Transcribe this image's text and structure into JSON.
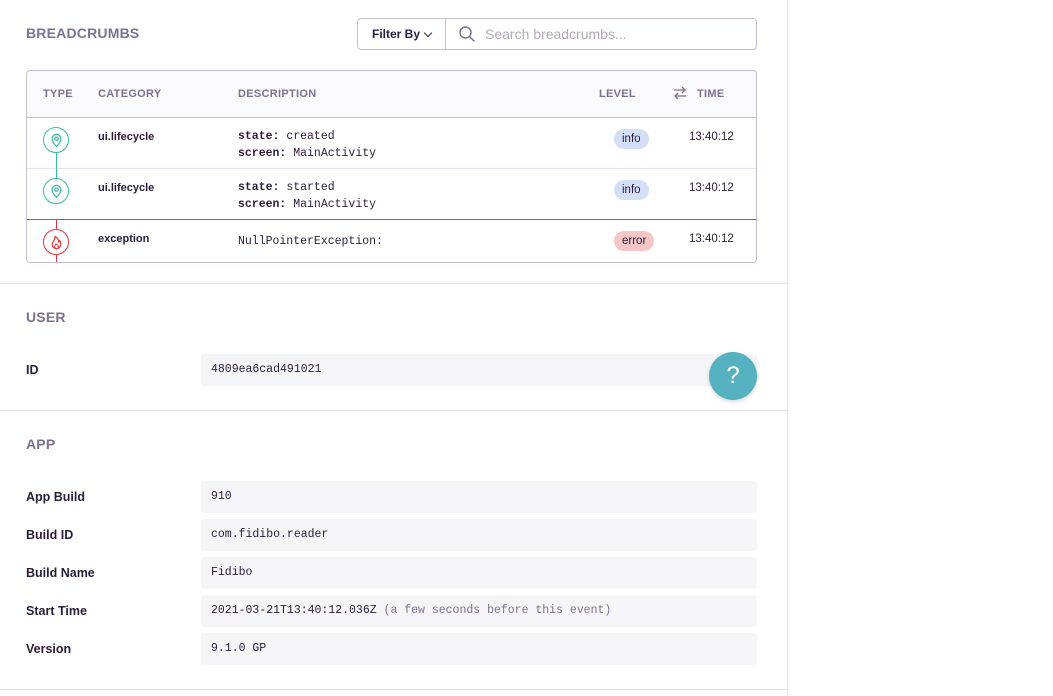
{
  "breadcrumbs": {
    "title": "BREADCRUMBS",
    "filter_label": "Filter By",
    "search_placeholder": "Search breadcrumbs...",
    "columns": {
      "type": "TYPE",
      "category": "CATEGORY",
      "description": "DESCRIPTION",
      "level": "LEVEL",
      "time": "TIME"
    },
    "rows": [
      {
        "icon": "location-pin-icon",
        "category": "ui.lifecycle",
        "desc_key1": "state:",
        "desc_val1": "created",
        "desc_key2": "screen:",
        "desc_val2": "MainActivity",
        "level": "info",
        "time": "13:40:12"
      },
      {
        "icon": "location-pin-icon",
        "category": "ui.lifecycle",
        "desc_key1": "state:",
        "desc_val1": "started",
        "desc_key2": "screen:",
        "desc_val2": "MainActivity",
        "level": "info",
        "time": "13:40:12"
      },
      {
        "icon": "fire-icon",
        "category": "exception",
        "desc_text": "NullPointerException:",
        "level": "error",
        "time": "13:40:12"
      }
    ],
    "colors": {
      "info_icon": "#33bf9e",
      "error_icon": "#e6353d",
      "info_badge": "#d2dff7",
      "error_badge": "#f7c6c7"
    }
  },
  "user": {
    "title": "USER",
    "id_label": "ID",
    "id_value": "4809ea6cad491021"
  },
  "app": {
    "title": "APP",
    "fields": [
      {
        "label": "App Build",
        "value": "910"
      },
      {
        "label": "Build ID",
        "value": "com.fidibo.reader"
      },
      {
        "label": "Build Name",
        "value": "Fidibo"
      },
      {
        "label": "Start Time",
        "value": "2021-03-21T13:40:12.036Z",
        "note": "(a few seconds before this event)"
      },
      {
        "label": "Version",
        "value": "9.1.0 GP"
      }
    ]
  },
  "help": {
    "label": "?",
    "icon": "help-icon",
    "color": "#56b1c0"
  }
}
